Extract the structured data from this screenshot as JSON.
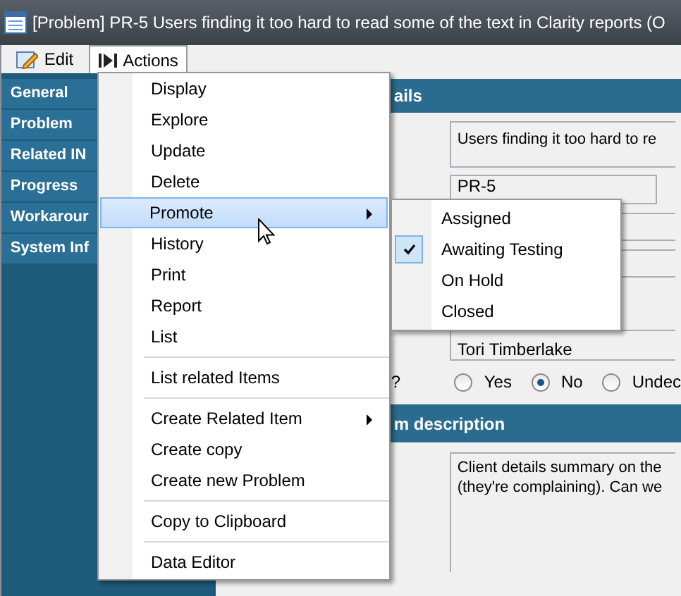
{
  "window": {
    "title": "[Problem] PR-5 Users finding it too hard to read some of the text in Clarity reports (O"
  },
  "toolbar": [
    {
      "label": "Edit",
      "kind": "edit",
      "selected": false
    },
    {
      "label": "Actions",
      "kind": "actions",
      "selected": true
    }
  ],
  "sidebar": {
    "items": [
      {
        "label": "General"
      },
      {
        "label": "Problem"
      },
      {
        "label": "Related IN"
      },
      {
        "label": "Progress"
      },
      {
        "label": "Workarour"
      },
      {
        "label": "System Inf"
      }
    ]
  },
  "details": {
    "header": "ails",
    "summary": "Users finding it too hard to re",
    "id": "PR-5",
    "assignee": "Tori Timberlake",
    "question_label": "?",
    "options": [
      {
        "label": "Yes",
        "selected": false
      },
      {
        "label": "No",
        "selected": true
      },
      {
        "label": "Undec",
        "selected": false
      }
    ]
  },
  "description": {
    "header": "m description",
    "text": "Client details summary on the\n(they're complaining). Can we"
  },
  "menu": {
    "items": [
      {
        "kind": "item",
        "label": "Display",
        "selected": false,
        "has_submenu": false
      },
      {
        "kind": "item",
        "label": "Explore",
        "selected": false,
        "has_submenu": false
      },
      {
        "kind": "item",
        "label": "Update",
        "selected": false,
        "has_submenu": false
      },
      {
        "kind": "item",
        "label": "Delete",
        "selected": false,
        "has_submenu": false
      },
      {
        "kind": "item",
        "label": "Promote",
        "selected": true,
        "has_submenu": true
      },
      {
        "kind": "item",
        "label": "History",
        "selected": false,
        "has_submenu": false
      },
      {
        "kind": "item",
        "label": "Print",
        "selected": false,
        "has_submenu": false
      },
      {
        "kind": "item",
        "label": "Report",
        "selected": false,
        "has_submenu": false
      },
      {
        "kind": "item",
        "label": "List",
        "selected": false,
        "has_submenu": false
      },
      {
        "kind": "separator"
      },
      {
        "kind": "item",
        "label": "List related Items",
        "selected": false,
        "has_submenu": false
      },
      {
        "kind": "separator"
      },
      {
        "kind": "item",
        "label": "Create Related Item",
        "selected": false,
        "has_submenu": true
      },
      {
        "kind": "item",
        "label": "Create copy",
        "selected": false,
        "has_submenu": false
      },
      {
        "kind": "item",
        "label": "Create new Problem",
        "selected": false,
        "has_submenu": false
      },
      {
        "kind": "separator"
      },
      {
        "kind": "item",
        "label": "Copy to Clipboard",
        "selected": false,
        "has_submenu": false
      },
      {
        "kind": "separator"
      },
      {
        "kind": "item",
        "label": "Data Editor",
        "selected": false,
        "has_submenu": false
      }
    ]
  },
  "submenu": {
    "items": [
      {
        "label": "Assigned",
        "checked": false
      },
      {
        "label": "Awaiting Testing",
        "checked": true
      },
      {
        "label": "On Hold",
        "checked": false
      },
      {
        "label": "Closed",
        "checked": false
      }
    ]
  }
}
